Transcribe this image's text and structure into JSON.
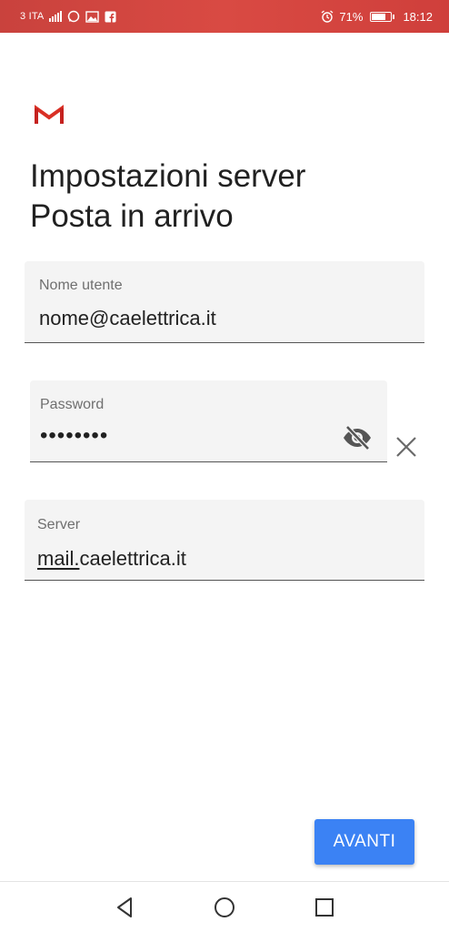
{
  "status_bar": {
    "carrier": "3 ITA",
    "battery_percent": "71%",
    "time": "18:12",
    "icons": [
      "signal-icon",
      "whatsapp-icon",
      "gallery-icon",
      "facebook-icon",
      "alarm-icon",
      "battery-icon"
    ]
  },
  "header": {
    "logo": "gmail-logo",
    "title_line1": "Impostazioni server",
    "title_line2": "Posta in arrivo"
  },
  "form": {
    "username": {
      "label": "Nome utente",
      "value": "nome@caelettrica.it"
    },
    "password": {
      "label": "Password",
      "value": "••••••••"
    },
    "server": {
      "label": "Server",
      "value_prefix": "mail.",
      "value_suffix": "caelettrica.it"
    }
  },
  "actions": {
    "next_label": "AVANTI"
  },
  "colors": {
    "status_bar": "#d3443f",
    "accent": "#3b82f4",
    "field_bg": "#f4f4f4",
    "gmail_red": "#d93025"
  }
}
